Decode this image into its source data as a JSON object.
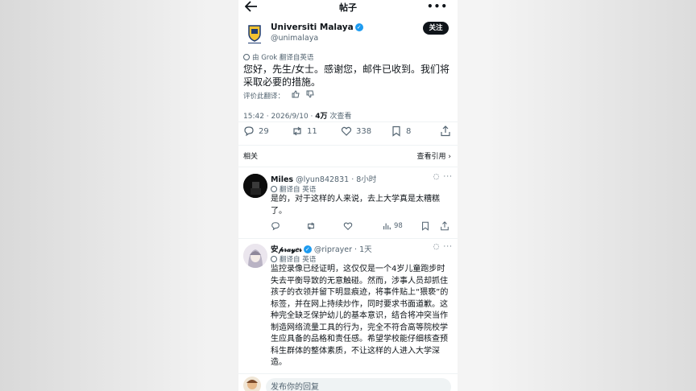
{
  "header": {
    "title": "帖子",
    "more": "•••"
  },
  "post": {
    "author_name": "Universiti Malaya",
    "author_handle": "@unimalaya",
    "follow_label": "关注",
    "translation_note": "由 Grok 翻译自英语",
    "text": "您好，先生/女士。感谢您，邮件已收到。我们将采取必要的措施。",
    "rate_label": "评价此翻译：",
    "meta_time": "15:42 · 2026/9/10 · ",
    "meta_views_count": "4万",
    "meta_views_label": " 次查看",
    "stats": {
      "replies": "29",
      "reposts": "11",
      "likes": "338",
      "bookmarks": "8"
    }
  },
  "related": {
    "label": "相关",
    "view_quotes": "查看引用 ›"
  },
  "replies": [
    {
      "name": "Miles",
      "handle": "@lyun842831 · 8小时",
      "translated": "翻译自 英语",
      "text": "是的，对于这样的人来说，去上大学真是太糟糕了。",
      "views": "98",
      "more": "···"
    },
    {
      "name": "安𝓅𝓇𝒶𝓎𝑒𝓇",
      "handle": "@riprayer · 1天",
      "translated": "翻译自 英语",
      "text": "监控录像已经证明，这仅仅是一个4岁儿童跑步时失去平衡导致的无意触碰。然而，涉事人员却抓住孩子的衣领并留下明显痕迹，将事件贴上“猥亵”的标签，并在网上持续炒作，同时要求书面道歉。这种完全缺乏保护幼儿的基本意识，结合将冲突当作制造网络流量工具的行为，完全不符合高等院校学生应具备的品格和责任感。希望学校能仔细核查预科生群体的整体素质，不让这样的人进入大学深造。",
      "more": "···"
    }
  ],
  "reply_box": {
    "placeholder": "发布你的回复"
  },
  "colors": {
    "accent": "#1d9bf0",
    "text": "#0f1419",
    "muted": "#536471"
  }
}
